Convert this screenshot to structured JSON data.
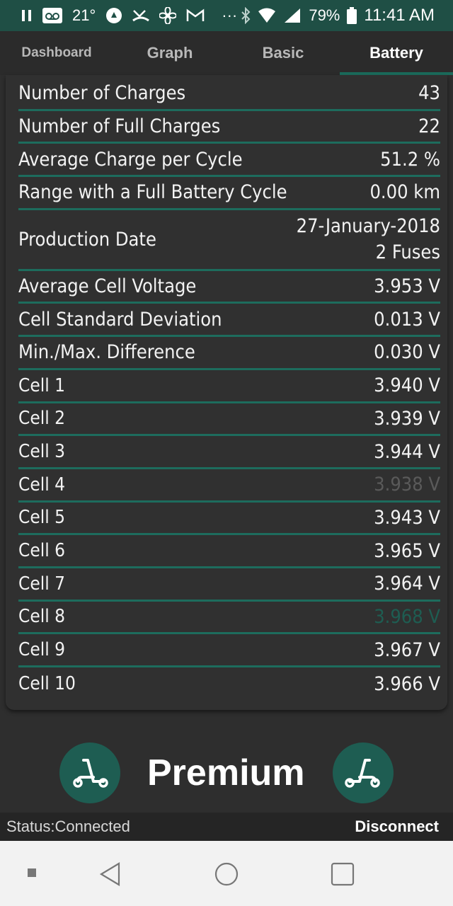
{
  "status_bar": {
    "temperature": "21°",
    "battery": "79%",
    "time": "11:41 AM",
    "more": "···"
  },
  "tabs": [
    {
      "label": "Dashboard",
      "active": false
    },
    {
      "label": "Graph",
      "active": false
    },
    {
      "label": "Basic",
      "active": false
    },
    {
      "label": "Battery",
      "active": true
    }
  ],
  "battery_rows": [
    {
      "label": "Number of Charges",
      "value": "43"
    },
    {
      "label": "Number of Full Charges",
      "value": "22"
    },
    {
      "label": "Average Charge per Cycle",
      "value": "51.2 %"
    },
    {
      "label": "Range with a Full Battery Cycle",
      "value": "0.00 km"
    },
    {
      "label": "Production Date",
      "value": "27-January-2018",
      "value2": "2 Fuses"
    },
    {
      "label": "Average Cell Voltage",
      "value": "3.953 V"
    },
    {
      "label": "Cell Standard Deviation",
      "value": "0.013 V"
    },
    {
      "label": "Min./Max. Difference",
      "value": "0.030 V"
    },
    {
      "label": "Cell 1",
      "value": "3.940 V"
    },
    {
      "label": "Cell 2",
      "value": "3.939 V"
    },
    {
      "label": "Cell 3",
      "value": "3.944 V"
    },
    {
      "label": "Cell 4",
      "value": "3.938 V"
    },
    {
      "label": "Cell 5",
      "value": "3.943 V"
    },
    {
      "label": "Cell 6",
      "value": "3.965 V"
    },
    {
      "label": "Cell 7",
      "value": "3.964 V"
    },
    {
      "label": "Cell 8",
      "value": "3.968 V"
    },
    {
      "label": "Cell 9",
      "value": "3.967 V"
    },
    {
      "label": "Cell 10",
      "value": "3.966 V"
    }
  ],
  "premium": {
    "label": "Premium",
    "icon": "scooter-icon"
  },
  "bottom": {
    "status": "Status:Connected",
    "disconnect": "Disconnect"
  },
  "colors": {
    "accent": "#1d6c5d",
    "status_bar": "#1f4f45",
    "background": "#2e2e2e"
  }
}
